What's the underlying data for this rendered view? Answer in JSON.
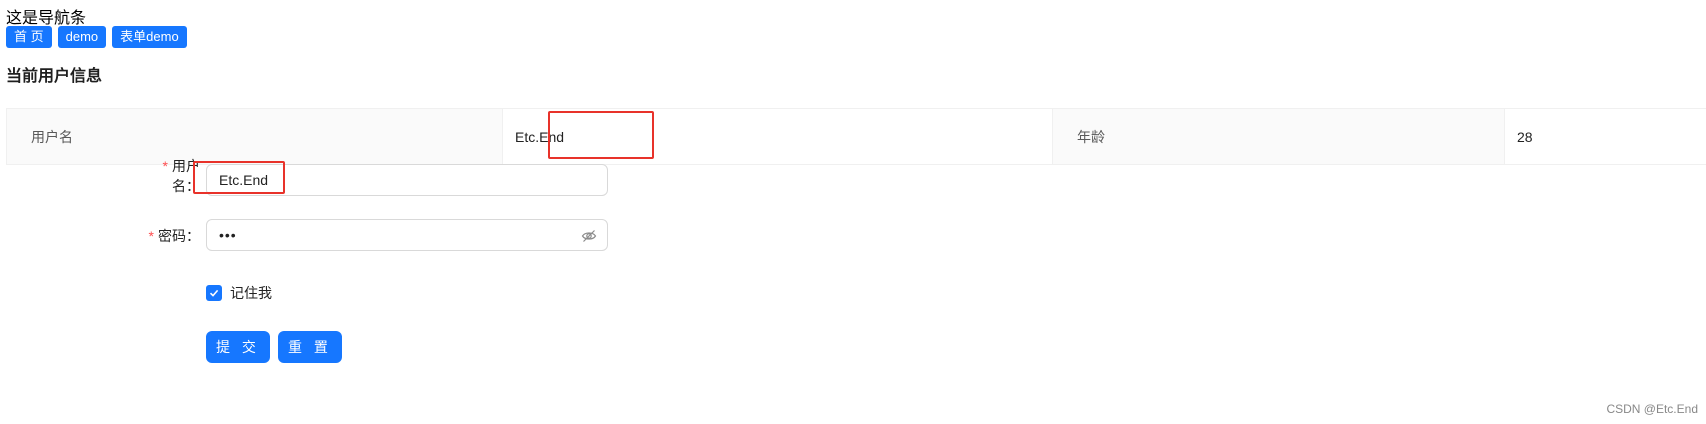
{
  "nav": {
    "title": "这是导航条",
    "links": [
      "首 页",
      "demo",
      "表单demo"
    ]
  },
  "section_title": "当前用户信息",
  "descriptions": {
    "username_label": "用户名",
    "username_value": "Etc.End",
    "age_label": "年龄",
    "age_value": "28"
  },
  "form": {
    "username_label": "用户名",
    "username_value": "Etc.End",
    "password_label": "密码",
    "password_value": "•••",
    "remember_label": "记住我",
    "remember_checked": true,
    "submit_label": "提 交",
    "reset_label": "重 置"
  },
  "colors": {
    "primary": "#1677ff",
    "required": "#ff4d4f",
    "highlight": "#e8322a"
  },
  "watermark": "CSDN @Etc.End"
}
